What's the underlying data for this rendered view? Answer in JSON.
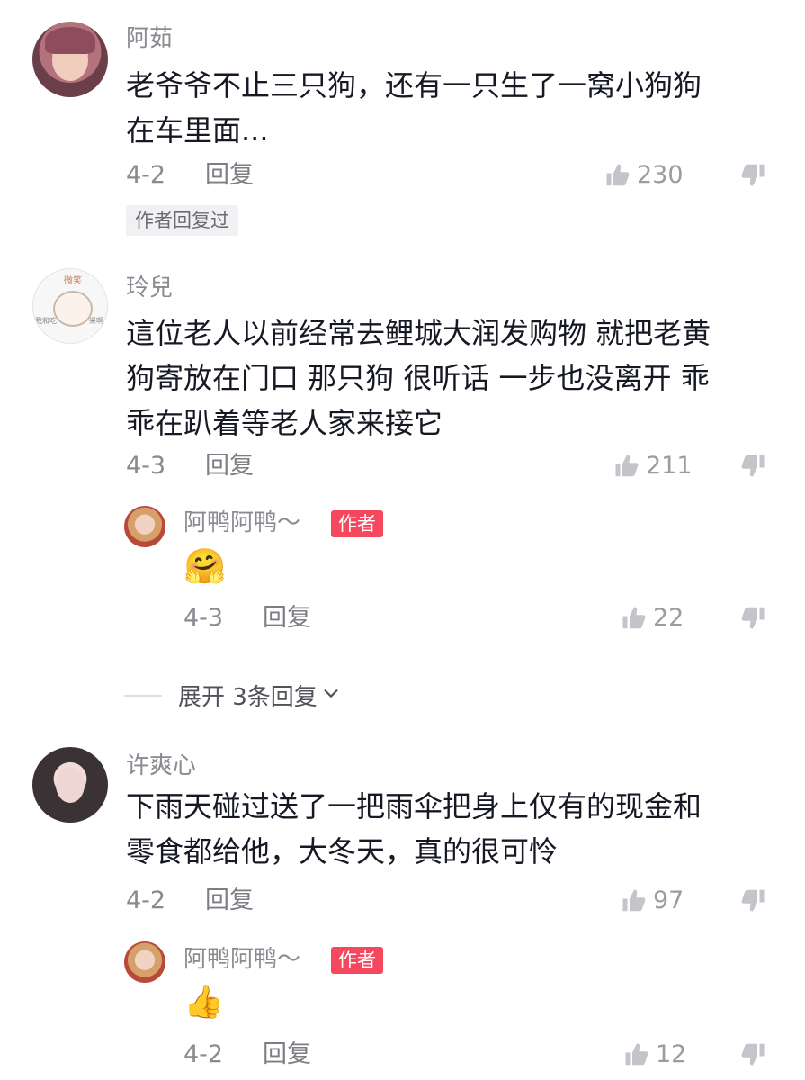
{
  "colors": {
    "text": "#161823",
    "secondary": "#8a8b91",
    "badge": "#f5475e",
    "tag_bg": "#f1f1f3"
  },
  "comments": [
    {
      "username": "阿茹",
      "lines": [
        "老爷爷不止三只狗，还有一只生了一窝小狗狗",
        "在车里面..."
      ],
      "date": "4-2",
      "reply_label": "回复",
      "likes": "230",
      "author_replied_tag": "作者回复过"
    },
    {
      "username": "玲兒",
      "avatar_text": [
        "微笑",
        "我和吃",
        "采啊"
      ],
      "lines": [
        "這位老人以前经常去鲤城大润发购物 就把老黄",
        "狗寄放在门口  那只狗 很听话 一步也没离开  乖",
        "乖在趴着等老人家来接它"
      ],
      "date": "4-3",
      "reply_label": "回复",
      "likes": "211",
      "replies": [
        {
          "username": "阿鸭阿鸭～",
          "badge": "作者",
          "emoji": "🤗",
          "date": "4-3",
          "reply_label": "回复",
          "likes": "22"
        }
      ],
      "expand_label": "展开 3条回复"
    },
    {
      "username": "许爽心",
      "lines": [
        "下雨天碰过送了一把雨伞把身上仅有的现金和",
        "零食都给他，大冬天，真的很可怜"
      ],
      "date": "4-2",
      "reply_label": "回复",
      "likes": "97",
      "replies": [
        {
          "username": "阿鸭阿鸭～",
          "badge": "作者",
          "emoji": "👍",
          "date": "4-2",
          "reply_label": "回复",
          "likes": "12"
        }
      ]
    }
  ]
}
